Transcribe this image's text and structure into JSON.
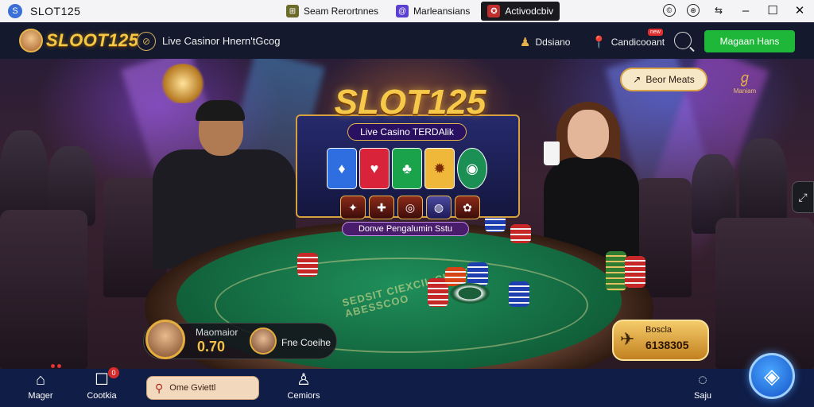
{
  "window": {
    "app_name": "SLOT125",
    "app_icon": "S",
    "tabs": [
      {
        "label": "Seam Rerortnnes",
        "icon": "⊞",
        "color": "#6b6b2b"
      },
      {
        "label": "Marleansians",
        "icon": "@",
        "color": "#5a3fd0"
      },
      {
        "label": "Activodcbiv",
        "icon": "✪",
        "color": "#c22d2d",
        "active": true
      }
    ],
    "controls": {
      "c1": "©",
      "c2": "⊕",
      "c3": "⇆",
      "minimize": "–",
      "maximize": "☐",
      "close": "✕"
    }
  },
  "header": {
    "logo_text": "SLOOT125",
    "live_icon": "⊘",
    "live_text": "Live Casinor Hnern'tGcog",
    "item1_label": "Ddsiano",
    "item1_icon": "♟",
    "item2_label": "Candicooant",
    "item2_icon": "📍",
    "item2_badge": "new",
    "login_label": "Magaan Hans"
  },
  "scene": {
    "promo_title": "SLOT125",
    "promo_subtitle": "Live Casino TERDAlik",
    "promo_button": "Donve Pengalumin Sstu",
    "cards": [
      "♦",
      "♥",
      "♣",
      "✹",
      "◉"
    ],
    "card_colors": [
      "#2f6ee0",
      "#d8233a",
      "#1aa34a",
      "#f0b83a",
      "#1c8f54"
    ],
    "gems": [
      "✦",
      "✚",
      "◎",
      "◍",
      "✿"
    ],
    "felt_text": "SEDSIT CIEXCIL CIKGE ABESSCOO",
    "best_button": "Beor Meats",
    "best_icon": "↗",
    "brand_glyph": "ℊ",
    "brand_text": "Maniam",
    "side_handle_icon": "⤢"
  },
  "player": {
    "label": "Maomaior",
    "value": "0.70",
    "second_label": "Fne Coeihe"
  },
  "bonus": {
    "icon": "✈",
    "title": "Boscla",
    "value": "6138305"
  },
  "nav": {
    "items": [
      {
        "label": "Mager",
        "icon": "⌂"
      },
      {
        "label": "Cootkia",
        "icon": "☐",
        "badge": "0"
      },
      {
        "label": "Cemiors",
        "icon": "♙"
      },
      {
        "label": "Saju",
        "icon": "◌"
      }
    ],
    "search_label": "Ome Gviettl",
    "search_icon": "⚲",
    "fab_icon": "◈"
  }
}
